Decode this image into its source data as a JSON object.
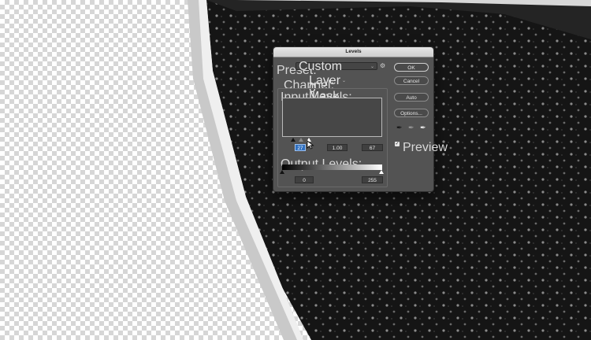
{
  "dialog": {
    "title": "Levels",
    "preset_label": "Preset:",
    "preset_value": "Custom",
    "channel_label": "Channel:",
    "channel_value": "Layer 0 Mask",
    "input_levels_label": "Input Levels:",
    "input_black": "27",
    "input_gamma": "1.00",
    "input_white": "67",
    "output_levels_label": "Output Levels:",
    "output_black": "0",
    "output_white": "255",
    "preview_label": "Preview",
    "preview_checked": true
  },
  "buttons": {
    "ok": "OK",
    "cancel": "Cancel",
    "auto": "Auto",
    "options": "Options..."
  },
  "icons": {
    "preset_dropdown": "chevron-down-icon",
    "preset_options": "gear-icon",
    "black_eyedropper": "eyedropper-black-icon",
    "gray_eyedropper": "eyedropper-gray-icon",
    "white_eyedropper": "eyedropper-white-icon"
  },
  "colors": {
    "dialog_bg": "#535353",
    "active_field": "#2f6fbf"
  }
}
